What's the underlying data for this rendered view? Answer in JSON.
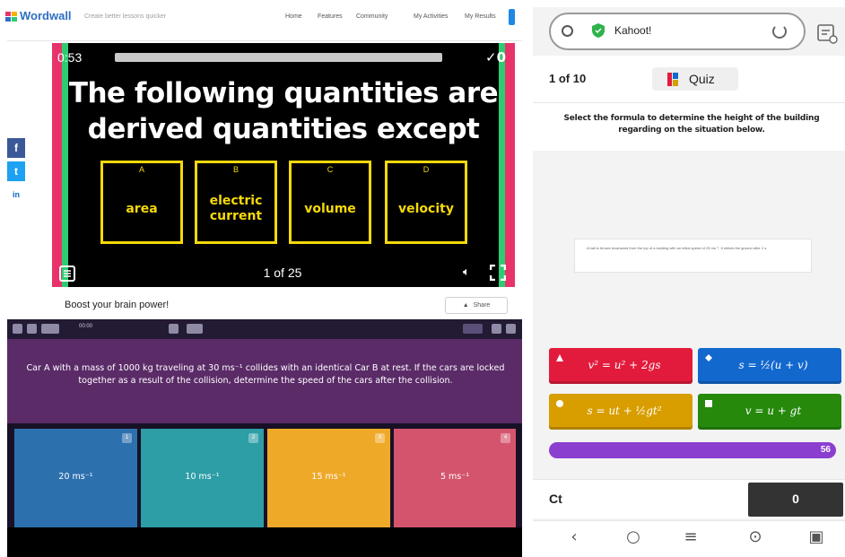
{
  "wordwall": {
    "logo": "Wordwall",
    "tagline": "Create better lessons quicker",
    "nav": [
      "Home",
      "Features",
      "Community",
      "My Activities",
      "My Results"
    ],
    "social": [
      "f",
      "t",
      "in"
    ],
    "timer": "0:53",
    "score": "0",
    "question": "The following quantities are derived quantities except",
    "answers": [
      {
        "letter": "A",
        "text": "area"
      },
      {
        "letter": "B",
        "text": "electric current"
      },
      {
        "letter": "C",
        "text": "volume"
      },
      {
        "letter": "D",
        "text": "velocity"
      }
    ],
    "page": "1 of 25",
    "footer_text": "Boost your brain power!",
    "share_label": "Share"
  },
  "quizizz": {
    "toolbar_text": "00:00",
    "question": "Car A with a mass of 1000 kg traveling at 30 ms⁻¹ collides with an identical Car B at rest. If the cars are locked together as a result of the collision, determine the speed of the cars after the collision.",
    "options": [
      {
        "num": "1",
        "text": "20 ms⁻¹",
        "color": "#2d70ae"
      },
      {
        "num": "2",
        "text": "10 ms⁻¹",
        "color": "#2d9da6"
      },
      {
        "num": "3",
        "text": "15 ms⁻¹",
        "color": "#efa929"
      },
      {
        "num": "4",
        "text": "5 ms⁻¹",
        "color": "#d5546d"
      }
    ]
  },
  "kahoot": {
    "url": "Kahoot!",
    "counter": "1 of 10",
    "mode_label": "Quiz",
    "question": "Select the formula to determine the height of the building regarding on the situation below.",
    "image_text": "A ball is thrown downward from the top of a building with an initial speed of 25 ms⁻¹. It strikes the ground after 2 s.",
    "answers": [
      {
        "shape": "triangle",
        "text": "v² = u² + 2gs",
        "color": "#e21b3c"
      },
      {
        "shape": "diamond",
        "text": "s = ½(u + v)",
        "color": "#1368ce"
      },
      {
        "shape": "circle",
        "text": "s = ut + ½gt²",
        "color": "#d89e00"
      },
      {
        "shape": "square",
        "text": "v = u + gt",
        "color": "#26890c"
      }
    ],
    "progress_value": "56",
    "player": "Ct",
    "score": "0",
    "nav_icons": [
      "back-icon",
      "search-icon",
      "menu-icon",
      "assistant-icon",
      "tabs-icon"
    ]
  }
}
